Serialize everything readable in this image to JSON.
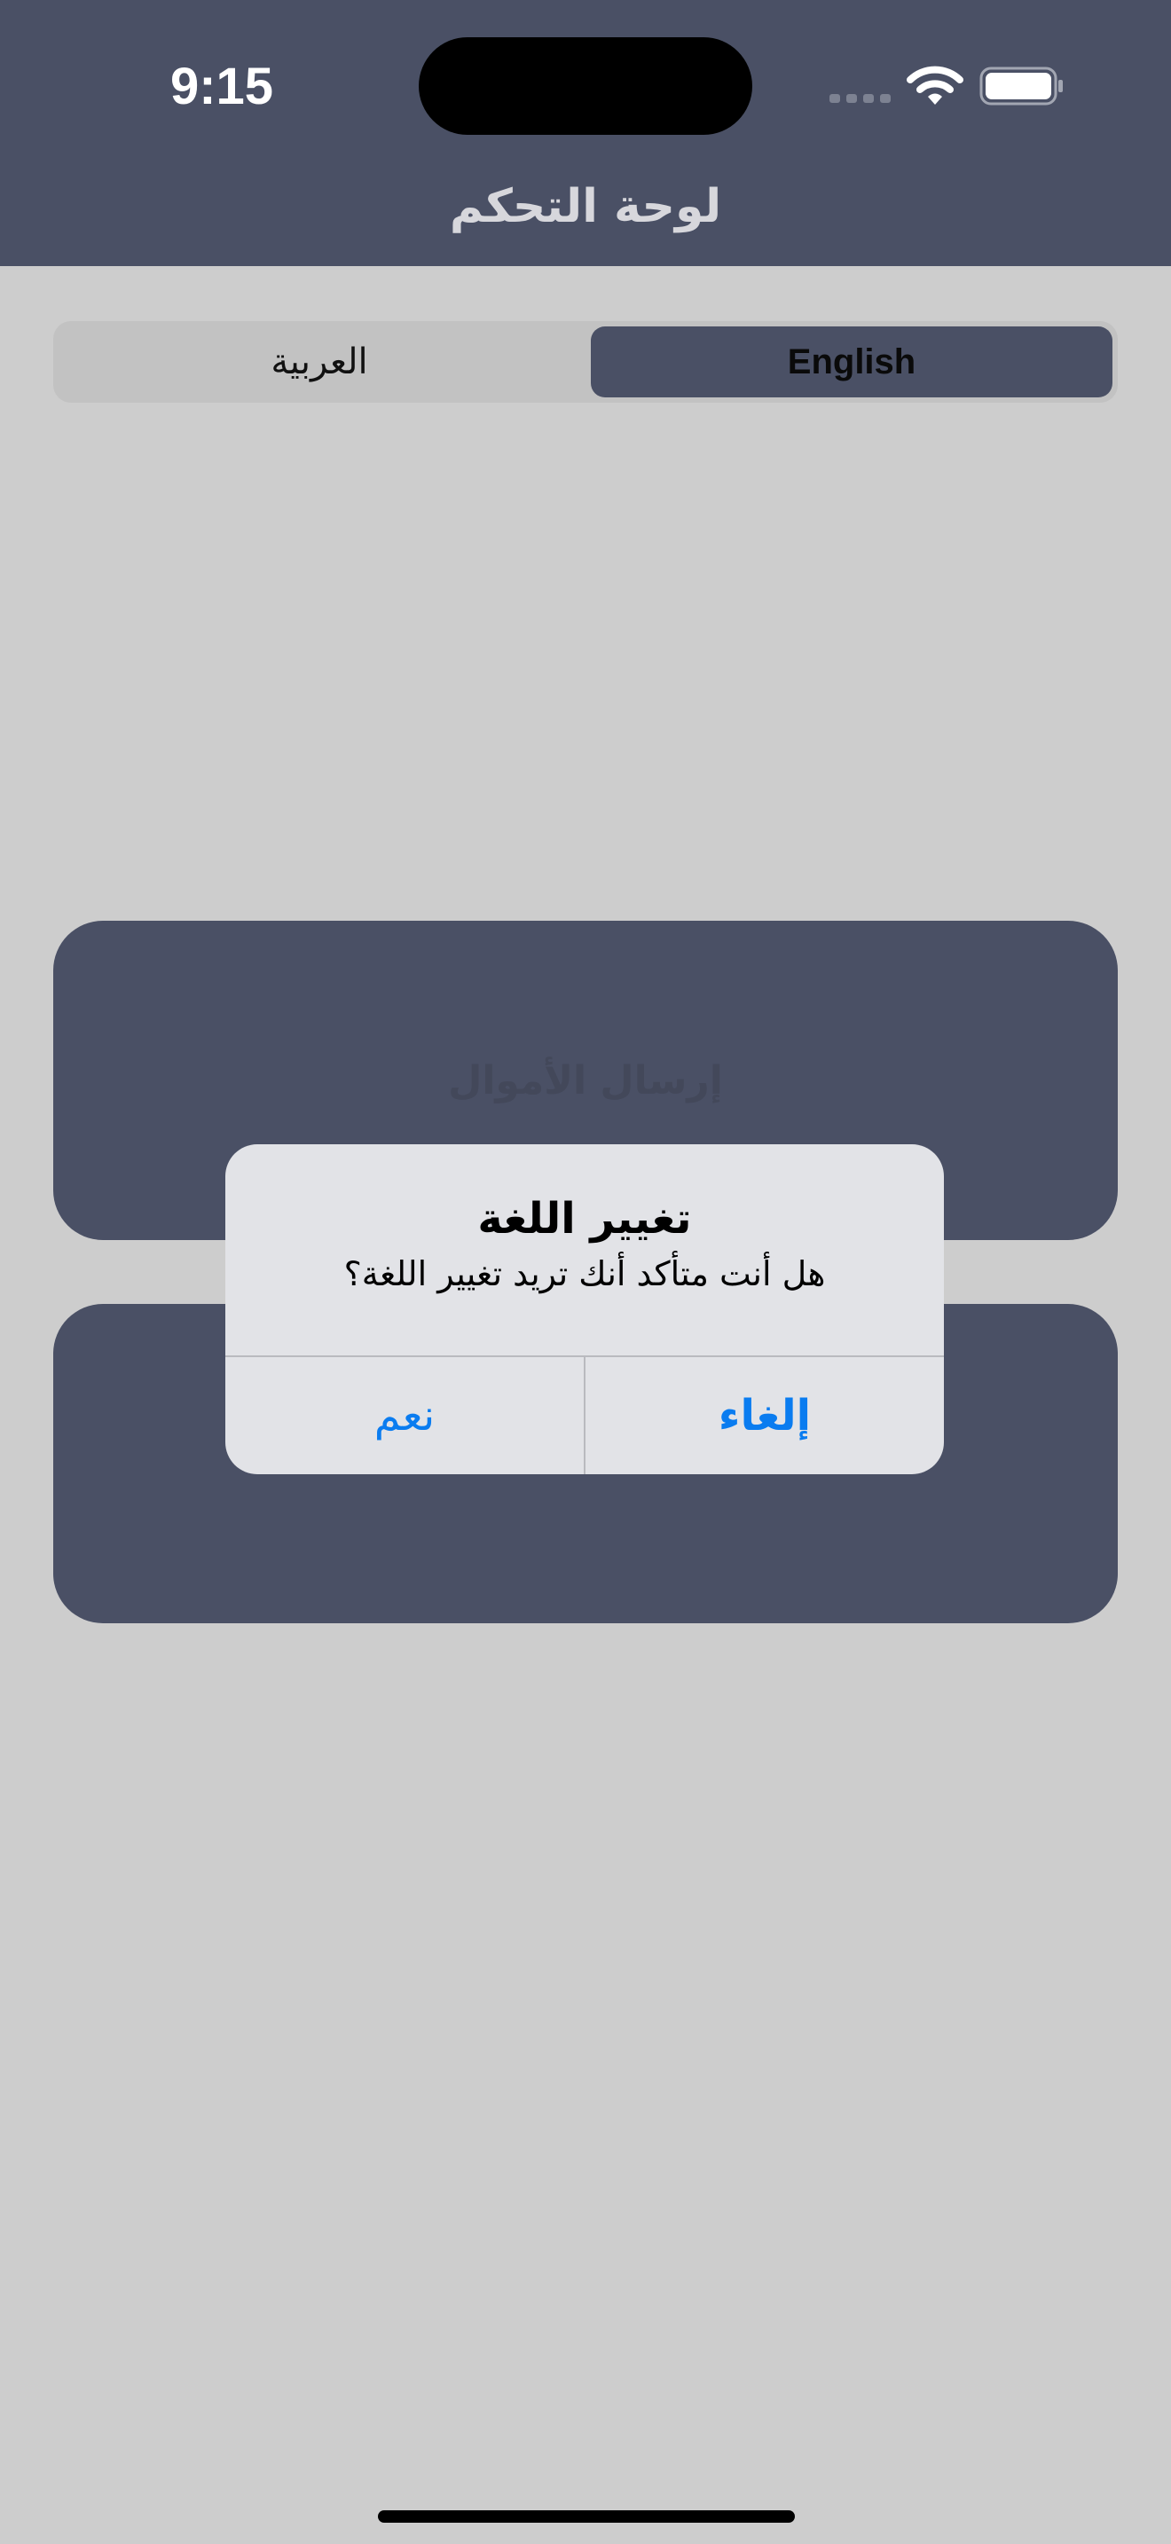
{
  "status_bar": {
    "time": "9:15",
    "icons": [
      "cellular-signal-icon",
      "wifi-icon",
      "battery-icon"
    ]
  },
  "nav": {
    "title": "لوحة التحكم"
  },
  "language_control": {
    "options": [
      {
        "label": "العربية",
        "selected": false
      },
      {
        "label": "English",
        "selected": true
      }
    ]
  },
  "cards": {
    "send_label": "إرسال الأموال",
    "receive_label": ""
  },
  "alert": {
    "title": "تغيير اللغة",
    "message": "هل أنت متأكد أنك تريد تغيير اللغة؟",
    "cancel_label": "إلغاء",
    "confirm_label": "نعم"
  },
  "colors": {
    "header": "#4a5065",
    "background": "#cdcdcd",
    "accent": "#0a7cf0",
    "alert_background": "#e2e3e7"
  }
}
